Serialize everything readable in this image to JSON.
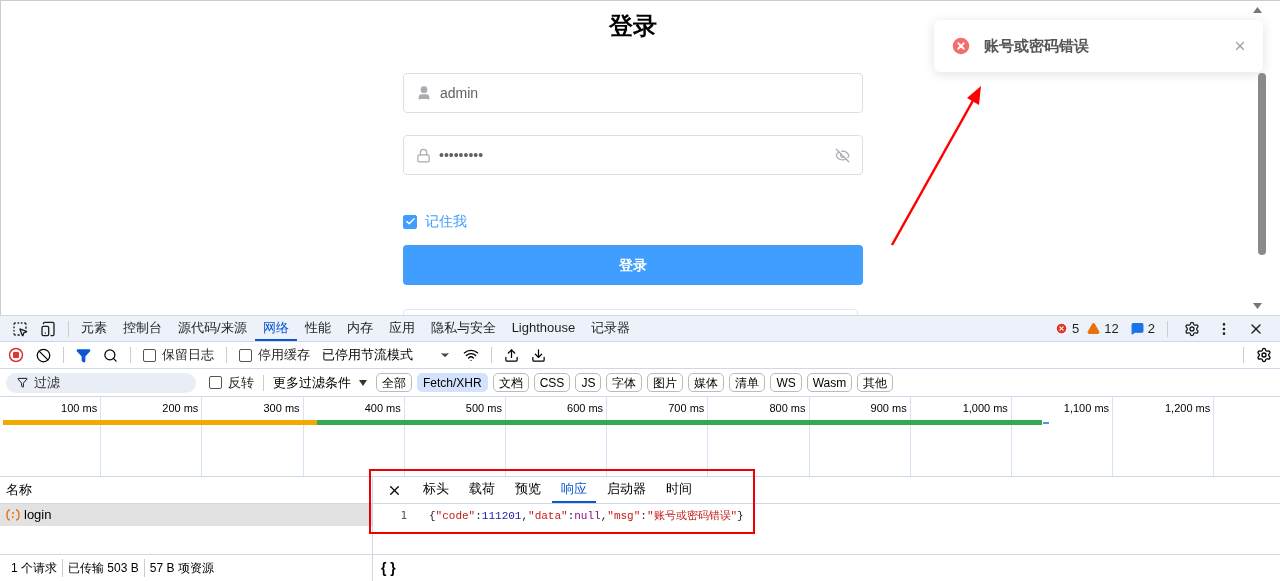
{
  "page": {
    "title": "登录",
    "username": {
      "value": "admin"
    },
    "password": {
      "value": "•••••••••"
    },
    "remember": {
      "label": "记住我",
      "checked": true
    },
    "submit": "登录"
  },
  "toast": {
    "kind": "error",
    "message": "账号或密码错误"
  },
  "devtools": {
    "tabs": [
      {
        "label": "元素",
        "selected": false
      },
      {
        "label": "控制台",
        "selected": false
      },
      {
        "label": "源代码/来源",
        "selected": false
      },
      {
        "label": "网络",
        "selected": true
      },
      {
        "label": "性能",
        "selected": false
      },
      {
        "label": "内存",
        "selected": false
      },
      {
        "label": "应用",
        "selected": false
      },
      {
        "label": "隐私与安全",
        "selected": false
      },
      {
        "label": "Lighthouse",
        "selected": false
      },
      {
        "label": "记录器",
        "selected": false
      }
    ],
    "counts": {
      "errors": "5",
      "warnings": "12",
      "messages": "2"
    },
    "toolbar": {
      "preserve_log": {
        "label": "保留日志",
        "checked": false
      },
      "disable_cache": {
        "label": "停用缓存",
        "checked": false
      },
      "throttle": "已停用节流模式"
    },
    "filter": {
      "placeholder": "过滤",
      "invert": {
        "label": "反转",
        "checked": false
      },
      "more": "更多过滤条件",
      "types": [
        {
          "label": "全部",
          "selected": false
        },
        {
          "label": "Fetch/XHR",
          "selected": true
        },
        {
          "label": "文档",
          "selected": false
        },
        {
          "label": "CSS",
          "selected": false
        },
        {
          "label": "JS",
          "selected": false
        },
        {
          "label": "字体",
          "selected": false
        },
        {
          "label": "图片",
          "selected": false
        },
        {
          "label": "媒体",
          "selected": false
        },
        {
          "label": "清单",
          "selected": false
        },
        {
          "label": "WS",
          "selected": false
        },
        {
          "label": "Wasm",
          "selected": false
        },
        {
          "label": "其他",
          "selected": false
        }
      ]
    },
    "timeline": {
      "ticks": [
        "100 ms",
        "200 ms",
        "300 ms",
        "400 ms",
        "500 ms",
        "600 ms",
        "700 ms",
        "800 ms",
        "900 ms",
        "1,000 ms",
        "1,100 ms",
        "1,200 ms"
      ]
    },
    "requests": {
      "column": "名称",
      "rows": [
        {
          "name": "login",
          "selected": true
        }
      ]
    },
    "detail": {
      "tabs": [
        {
          "label": "标头",
          "selected": false
        },
        {
          "label": "载荷",
          "selected": false
        },
        {
          "label": "预览",
          "selected": false
        },
        {
          "label": "响应",
          "selected": true
        },
        {
          "label": "启动器",
          "selected": false
        },
        {
          "label": "时间",
          "selected": false
        }
      ],
      "lines": [
        {
          "number": "1",
          "tokens": [
            {
              "kind": "punct",
              "text": "{"
            },
            {
              "kind": "key",
              "text": "\"code\""
            },
            {
              "kind": "punct",
              "text": ":"
            },
            {
              "kind": "number",
              "text": "111201"
            },
            {
              "kind": "punct",
              "text": ","
            },
            {
              "kind": "key",
              "text": "\"data\""
            },
            {
              "kind": "punct",
              "text": ":"
            },
            {
              "kind": "null",
              "text": "null"
            },
            {
              "kind": "punct",
              "text": ","
            },
            {
              "kind": "key",
              "text": "\"msg\""
            },
            {
              "kind": "punct",
              "text": ":"
            },
            {
              "kind": "string",
              "text": "\"账号或密码错误\""
            },
            {
              "kind": "punct",
              "text": "}"
            }
          ]
        }
      ]
    },
    "status": [
      "1 个请求",
      "已传输 503 B",
      "57 B 项资源"
    ],
    "format_button": "{ }"
  }
}
